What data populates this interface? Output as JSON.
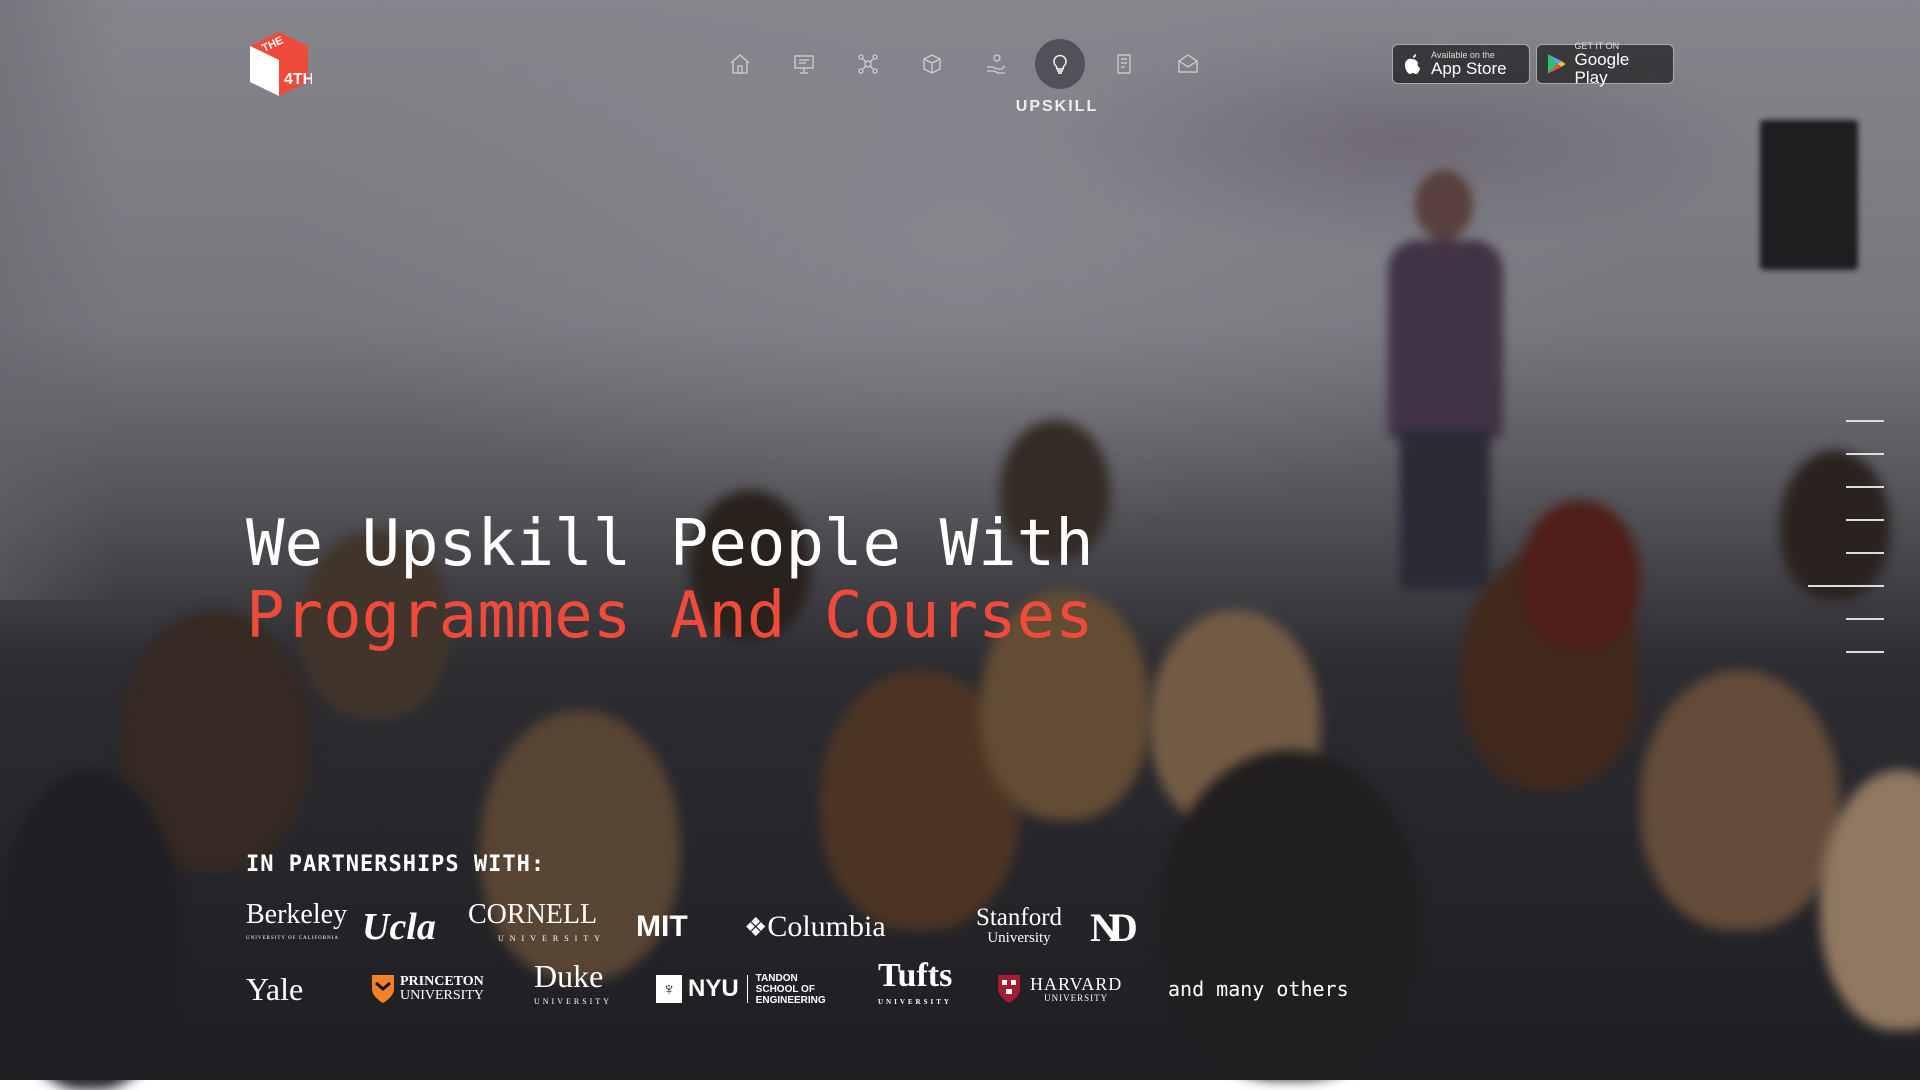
{
  "nav": {
    "items": [
      {
        "icon": "home-icon"
      },
      {
        "icon": "presentation-icon"
      },
      {
        "icon": "network-icon"
      },
      {
        "icon": "box-icon"
      },
      {
        "icon": "hand-coin-icon"
      },
      {
        "icon": "lightbulb-icon"
      },
      {
        "icon": "document-icon"
      },
      {
        "icon": "mail-icon"
      }
    ],
    "active_label": "UPSKILL"
  },
  "logo": {
    "text": "THE 4TH"
  },
  "stores": {
    "apple": {
      "small": "Available on the",
      "large": "App Store"
    },
    "google": {
      "small": "GET IT ON",
      "large": "Google Play"
    }
  },
  "hero": {
    "line1": "We Upskill People With",
    "line2": "Programmes And Courses"
  },
  "partners": {
    "title": "IN PARTNERSHIPS WITH:",
    "row1": [
      "Berkeley",
      "Ucla",
      "CORNELL",
      "MIT",
      "Columbia",
      "Stanford",
      "ND"
    ],
    "row1_sub": {
      "berkeley": "UNIVERSITY OF CALIFORNIA",
      "cornell": "UNIVERSITY",
      "stanford": "University"
    },
    "row2": [
      "Yale",
      "PRINCETON",
      "Duke",
      "NYU",
      "Tufts",
      "HARVARD"
    ],
    "row2_sub": {
      "princeton": "UNIVERSITY",
      "duke": "UNIVERSITY",
      "nyu": "TANDON SCHOOL OF ENGINEERING",
      "tufts": "UNIVERSITY",
      "harvard": "UNIVERSITY"
    },
    "others": "and many others"
  },
  "colors": {
    "accent": "#f04b3a"
  }
}
